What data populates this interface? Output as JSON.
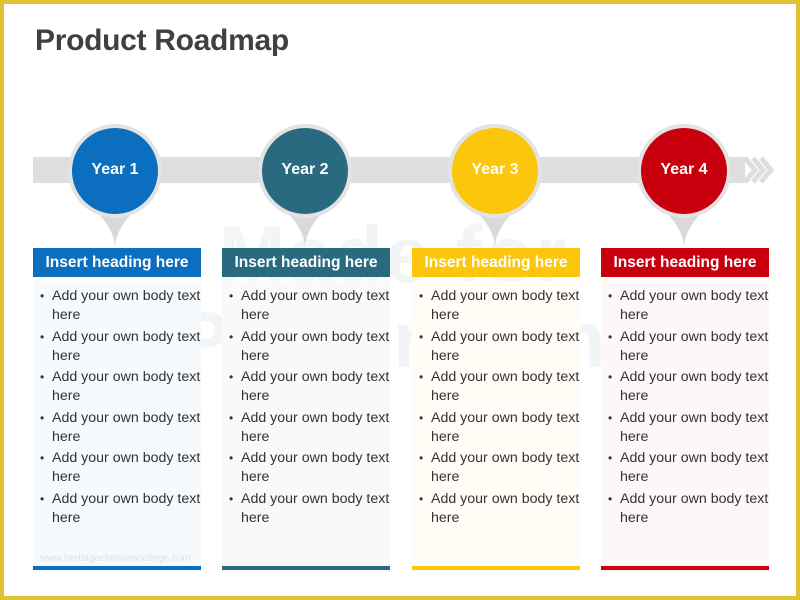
{
  "slide": {
    "title": "Product Roadmap",
    "frame_color": "#e0c232",
    "watermark": {
      "line1": "Made for",
      "line2": "PowerPoint",
      "url": "www.heritagechristiancollege.com"
    },
    "timeline": {
      "bar_color": "#dedede",
      "arrow_icon": "chevron-triple-right"
    },
    "milestones": [
      {
        "year_label": "Year 1",
        "color": "#0b6ebf",
        "tint": "#f6fafd",
        "heading": "Insert heading here",
        "items": [
          "Add your own body text here",
          "Add your own body text here",
          "Add your own body text here",
          "Add your own body text here",
          "Add your own body text here",
          "Add your own body text here"
        ]
      },
      {
        "year_label": "Year 2",
        "color": "#2a6a80",
        "tint": "#f7f9fa",
        "heading": "Insert heading here",
        "items": [
          "Add your own body text here",
          "Add your own body text here",
          "Add your own body text here",
          "Add your own body text here",
          "Add your own body text here",
          "Add your own body text here"
        ]
      },
      {
        "year_label": "Year 3",
        "color": "#fbc60b",
        "tint": "#fffdf6",
        "heading": "Insert heading here",
        "items": [
          "Add your own body text here",
          "Add your own body text here",
          "Add your own body text here",
          "Add your own body text here",
          "Add your own body text here",
          "Add your own body text here"
        ]
      },
      {
        "year_label": "Year 4",
        "color": "#c8000d",
        "tint": "#fdf7f7",
        "heading": "Insert heading here",
        "items": [
          "Add your own body text here",
          "Add your own body text here",
          "Add your own body text here",
          "Add your own body text here",
          "Add your own body text here",
          "Add your own body text here"
        ]
      }
    ]
  }
}
